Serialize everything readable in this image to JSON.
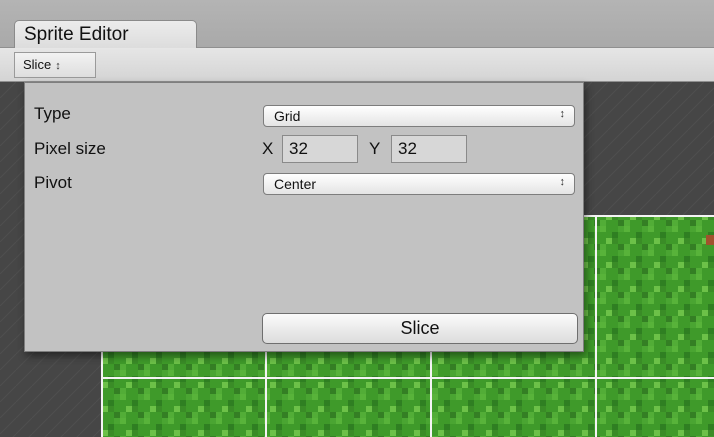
{
  "window": {
    "tab_title": "Sprite Editor"
  },
  "toolbar": {
    "slice_menu_label": "Slice",
    "slice_menu_arrows": "↕"
  },
  "slice_panel": {
    "type_label": "Type",
    "type_value": "Grid",
    "pixel_size_label": "Pixel size",
    "x_label": "X",
    "x_value": "32",
    "y_label": "Y",
    "y_value": "32",
    "pivot_label": "Pivot",
    "pivot_value": "Center",
    "slice_button_label": "Slice",
    "dropdown_arrows": "↕"
  },
  "colors": {
    "canvas_background": "#464646",
    "sprite_green": "#3f9a2a",
    "grid_line": "#ffffff"
  }
}
